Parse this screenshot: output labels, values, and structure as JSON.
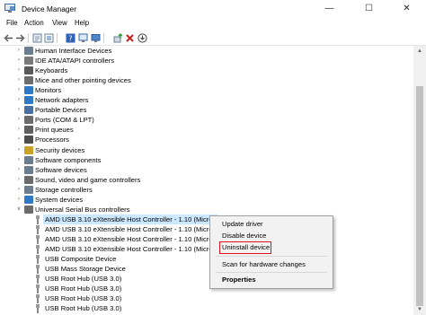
{
  "window": {
    "title": "Device Manager",
    "minimize": "—",
    "maximize": "☐",
    "close": "✕"
  },
  "menu": [
    "File",
    "Action",
    "View",
    "Help"
  ],
  "toolbar": {
    "items": [
      "back-arrow-icon",
      "forward-arrow-icon",
      "properties-icon",
      "show-hidden-icon",
      "help-icon",
      "device-icon",
      "update-driver-icon",
      "uninstall-icon",
      "scan-icon"
    ]
  },
  "tree": {
    "categories": [
      {
        "label": "Human Interface Devices",
        "icon": "hid-icon",
        "color": "#6b7d8f"
      },
      {
        "label": "IDE ATA/ATAPI controllers",
        "icon": "ide-icon",
        "color": "#7a7a7a"
      },
      {
        "label": "Keyboards",
        "icon": "keyboard-icon",
        "color": "#5a5a5a"
      },
      {
        "label": "Mice and other pointing devices",
        "icon": "mouse-icon",
        "color": "#6c6c6c"
      },
      {
        "label": "Monitors",
        "icon": "monitor-icon",
        "color": "#2f79c6"
      },
      {
        "label": "Network adapters",
        "icon": "network-icon",
        "color": "#2f79c6"
      },
      {
        "label": "Portable Devices",
        "icon": "portable-icon",
        "color": "#4a6fa5"
      },
      {
        "label": "Ports (COM & LPT)",
        "icon": "port-icon",
        "color": "#6b6b6b"
      },
      {
        "label": "Print queues",
        "icon": "printer-icon",
        "color": "#5f5f5f"
      },
      {
        "label": "Processors",
        "icon": "processor-icon",
        "color": "#4d4d4d"
      },
      {
        "label": "Security devices",
        "icon": "security-icon",
        "color": "#c9a227"
      },
      {
        "label": "Software components",
        "icon": "software-component-icon",
        "color": "#6b7d8f"
      },
      {
        "label": "Software devices",
        "icon": "software-device-icon",
        "color": "#6b7d8f"
      },
      {
        "label": "Sound, video and game controllers",
        "icon": "sound-icon",
        "color": "#6b6b6b"
      },
      {
        "label": "Storage controllers",
        "icon": "storage-icon",
        "color": "#6b7d8f"
      },
      {
        "label": "System devices",
        "icon": "system-icon",
        "color": "#2f79c6"
      },
      {
        "label": "Universal Serial Bus controllers",
        "icon": "usb-controller-icon",
        "color": "#6b6b6b"
      }
    ],
    "usb_children": [
      "AMD USB 3.10 eXtensible Host Controller - 1.10 (Micros",
      "AMD USB 3.10 eXtensible Host Controller - 1.10 (Micros",
      "AMD USB 3.10 eXtensible Host Controller - 1.10 (Micros",
      "AMD USB 3.10 eXtensible Host Controller - 1.10 (Micros",
      "USB Composite Device",
      "USB Mass Storage Device",
      "USB Root Hub (USB 3.0)",
      "USB Root Hub (USB 3.0)",
      "USB Root Hub (USB 3.0)",
      "USB Root Hub (USB 3.0)"
    ]
  },
  "context_menu": {
    "update": "Update driver",
    "disable": "Disable device",
    "uninstall": "Uninstall device",
    "scan": "Scan for hardware changes",
    "properties": "Properties",
    "highlight_color": "#e0141e"
  }
}
